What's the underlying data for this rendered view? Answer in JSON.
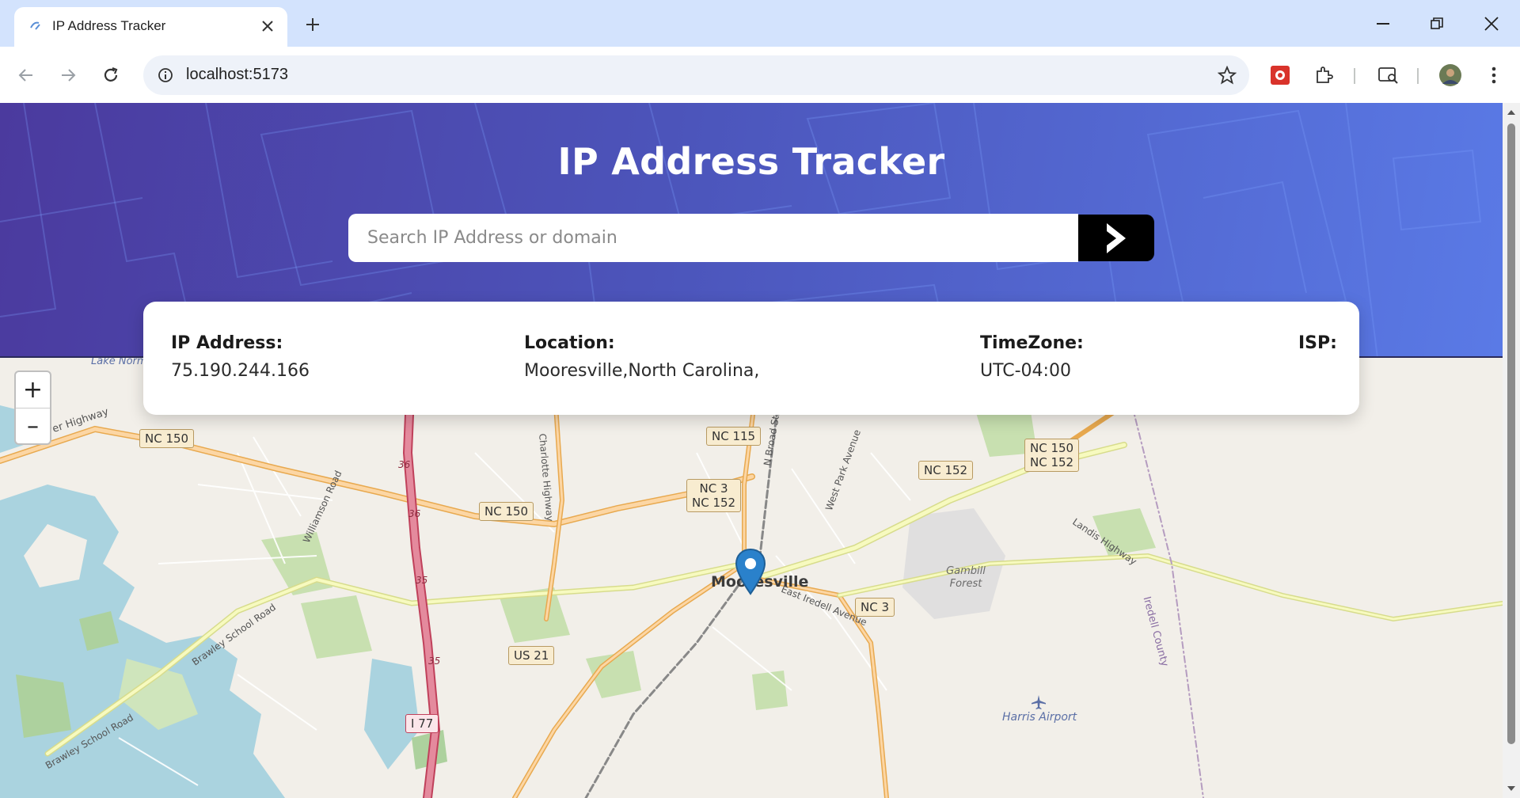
{
  "browser": {
    "tab_title": "IP Address Tracker",
    "url": "localhost:5173"
  },
  "page": {
    "title": "IP Address Tracker",
    "search_placeholder": "Search IP Address or domain"
  },
  "info": {
    "ip_label": "IP Address:",
    "ip_value": "75.190.244.166",
    "location_label": "Location:",
    "location_value": "Mooresville,North Carolina,",
    "timezone_label": "TimeZone:",
    "timezone_value": "UTC-04:00",
    "isp_label": "ISP:",
    "isp_value": ""
  },
  "map": {
    "zoom_in": "+",
    "zoom_out": "–",
    "labels": {
      "city": "Mooresville",
      "gambill_forest": "Gambill Forest",
      "harris_airport": "Harris Airport",
      "lake_norman_airport": "Lake Norman Airport",
      "iredell_county": "Iredell County",
      "landis_highway": "Landis Highway",
      "williamson_road": "Williamson Road",
      "brawley_school_road": "Brawley School Road",
      "brawley_school_road_2": "Brawley School Road",
      "charlotte_highway": "Charlotte Highway",
      "broad_street": "N Broad Street",
      "west_park_avenue": "West Park Avenue",
      "east_iredell_avenue": "East Iredell Avenue",
      "river_highway": "River Highway"
    },
    "shields": {
      "nc150_west": "NC 150",
      "nc150_mid": "NC 150",
      "nc115": "NC 115",
      "nc3_nc152_line1": "NC 3",
      "nc3_nc152_line2": "NC 152",
      "nc152_east": "NC 152",
      "nc150_nc152_line1": "NC 150",
      "nc150_nc152_line2": "NC 152",
      "nc3_south": "NC 3",
      "us21": "US 21",
      "i77": "I 77",
      "exit36a": "36",
      "exit36b": "36",
      "exit35": "35",
      "exit35b": "35"
    }
  }
}
